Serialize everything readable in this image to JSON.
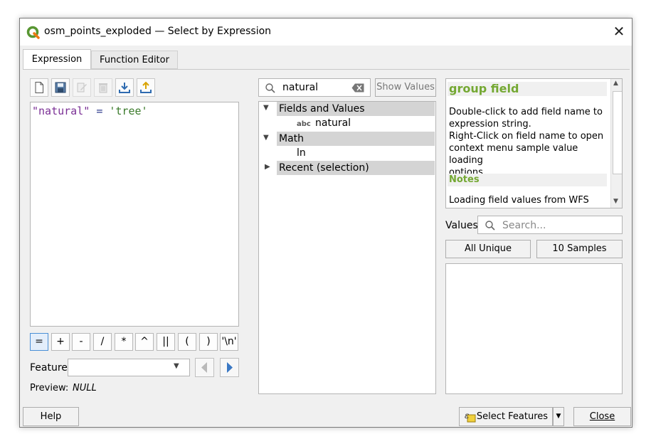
{
  "window": {
    "title": "osm_points_exploded — Select by Expression",
    "close_glyph": "✕"
  },
  "tabs": [
    {
      "label": "Expression",
      "active": true
    },
    {
      "label": "Function Editor",
      "active": false
    }
  ],
  "toolbar_icons": [
    "new-file-icon",
    "save-icon",
    "edit-icon",
    "delete-icon",
    "import-icon",
    "export-icon"
  ],
  "expression": {
    "field": "\"natural\"",
    "operator": "=",
    "value": "'tree'"
  },
  "operators": [
    "=",
    "+",
    "-",
    "/",
    "*",
    "^",
    "||",
    "(",
    ")",
    "'\\n'"
  ],
  "feature": {
    "label": "Feature",
    "value": ""
  },
  "preview": {
    "label": "Preview:",
    "value": "NULL"
  },
  "search": {
    "value": "natural",
    "show_values_label": "Show Values"
  },
  "tree": {
    "groups": [
      {
        "label": "Fields and Values",
        "expanded": true,
        "items": [
          {
            "badge": "abc",
            "label": "natural"
          }
        ]
      },
      {
        "label": "Math",
        "expanded": true,
        "items": [
          {
            "label": "ln"
          }
        ]
      },
      {
        "label": "Recent (selection)",
        "expanded": false,
        "items": []
      }
    ]
  },
  "help": {
    "heading": "group field",
    "line1": "Double-click to add field name to",
    "line2": "expression string.",
    "line3": "Right-Click on field name to open",
    "line4": "context menu sample value loading",
    "line5": "options.",
    "notes_heading": "Notes",
    "notes_line": "Loading field values from WFS"
  },
  "values": {
    "label": "Values",
    "search_placeholder": "Search...",
    "all_unique_label": "All Unique",
    "samples_label": "10 Samples"
  },
  "footer": {
    "help_label": "Help",
    "select_label": "Select Features",
    "close_label": "Close"
  },
  "colors": {
    "accent": "#589632",
    "help_heading": "#74a832",
    "keyword": "#7a2f95",
    "string": "#3a7a2a"
  }
}
